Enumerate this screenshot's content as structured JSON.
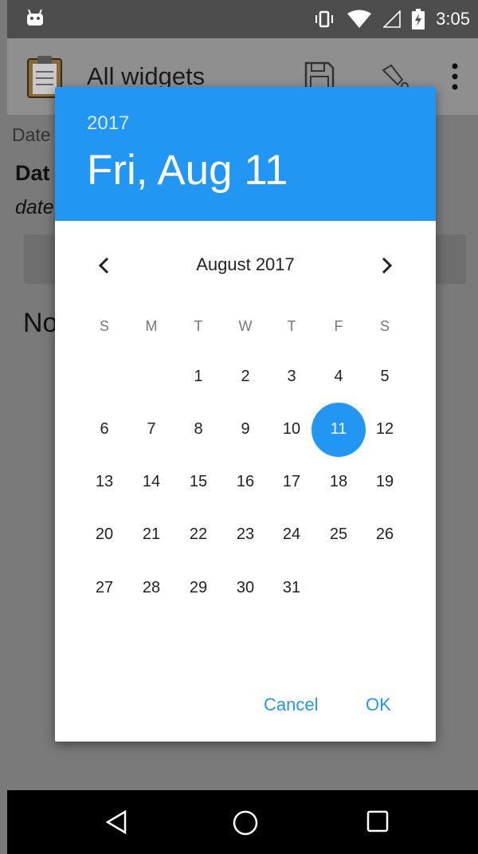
{
  "status_bar": {
    "time": "3:05",
    "icons": [
      "android-icon",
      "vibrate-icon",
      "wifi-icon",
      "signal-icon",
      "battery-charging-icon"
    ]
  },
  "app_bar": {
    "title": "All widgets",
    "icons": [
      "clipboard-icon",
      "save-icon",
      "pin-icon",
      "overflow-menu-icon"
    ]
  },
  "background": {
    "label_date": "Date",
    "label_bold": "Dat",
    "label_italic": "date",
    "label_large": "No"
  },
  "dialog": {
    "year": "2017",
    "selected_date": "Fri, Aug 11",
    "month_title": "August 2017",
    "weekdays": [
      "S",
      "M",
      "T",
      "W",
      "T",
      "F",
      "S"
    ],
    "weeks": [
      [
        "",
        "",
        "1",
        "2",
        "3",
        "4",
        "5"
      ],
      [
        "6",
        "7",
        "8",
        "9",
        "10",
        "11",
        "12"
      ],
      [
        "13",
        "14",
        "15",
        "16",
        "17",
        "18",
        "19"
      ],
      [
        "20",
        "21",
        "22",
        "23",
        "24",
        "25",
        "26"
      ],
      [
        "27",
        "28",
        "29",
        "30",
        "31",
        "",
        ""
      ]
    ],
    "selected_day": "11",
    "cancel_label": "Cancel",
    "ok_label": "OK",
    "accent_color": "#2196f3"
  },
  "nav_bar": {
    "icons": [
      "back-icon",
      "home-icon",
      "recents-icon"
    ]
  }
}
